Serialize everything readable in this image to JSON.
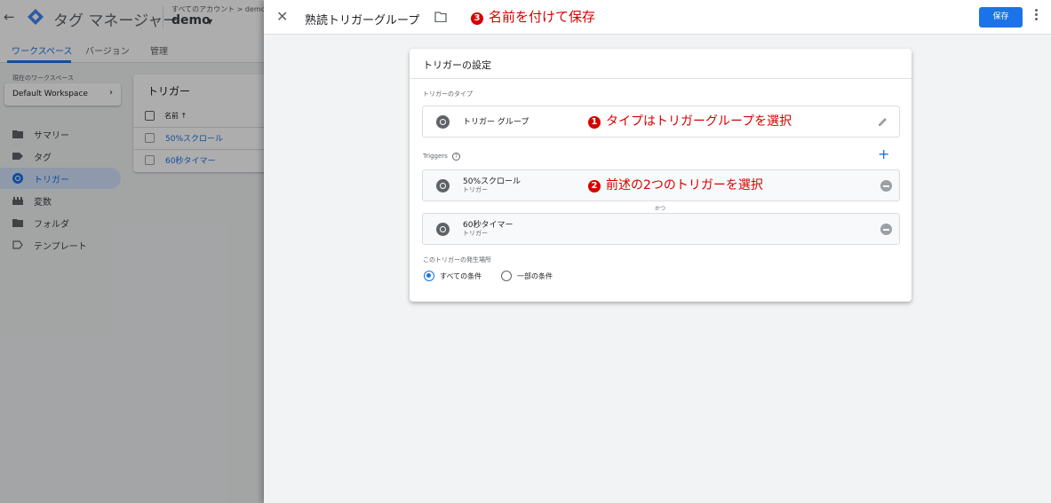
{
  "app": {
    "title": "タグ マネージャー",
    "account_breadcrumb": "すべてのアカウント > demo",
    "container_name": "demo"
  },
  "nav_tabs": [
    {
      "label": "ワークスペース",
      "active": true
    },
    {
      "label": "バージョン",
      "active": false
    },
    {
      "label": "管理",
      "active": false
    }
  ],
  "workspace": {
    "label": "現在のワークスペース",
    "name": "Default Workspace"
  },
  "sidebar": {
    "items": [
      {
        "label": "サマリー",
        "icon": "folder-icon",
        "active": false
      },
      {
        "label": "タグ",
        "icon": "tag-icon",
        "active": false
      },
      {
        "label": "トリガー",
        "icon": "trigger-icon",
        "active": true
      },
      {
        "label": "変数",
        "icon": "variables-icon",
        "active": false
      },
      {
        "label": "フォルダ",
        "icon": "folder-icon",
        "active": false
      },
      {
        "label": "テンプレート",
        "icon": "template-icon",
        "active": false
      }
    ]
  },
  "trigger_list": {
    "title": "トリガー",
    "column_name": "名前 ↑",
    "rows": [
      "50%スクロール",
      "60秒タイマー"
    ]
  },
  "panel": {
    "title": "熟読トリガーグループ",
    "save_label": "保存",
    "card_title": "トリガーの設定",
    "trigger_type_label": "トリガーのタイプ",
    "trigger_type_value": "トリガー グループ",
    "triggers_label": "Triggers",
    "triggers": [
      {
        "name": "50%スクロール",
        "type": "トリガー"
      },
      {
        "name": "60秒タイマー",
        "type": "トリガー"
      }
    ],
    "and_label": "かつ",
    "fire_label": "このトリガーの発生場所",
    "fire_options": [
      {
        "label": "すべての条件",
        "checked": true
      },
      {
        "label": "一部の条件",
        "checked": false
      }
    ]
  },
  "annotations": {
    "note1": {
      "num": "1",
      "text": "タイプはトリガーグループを選択"
    },
    "note2": {
      "num": "2",
      "text": "前述の2つのトリガーを選択"
    },
    "note3": {
      "num": "3",
      "text": "名前を付けて保存"
    }
  },
  "colors": {
    "accent": "#1a73e8",
    "annotation": "#d50000"
  }
}
